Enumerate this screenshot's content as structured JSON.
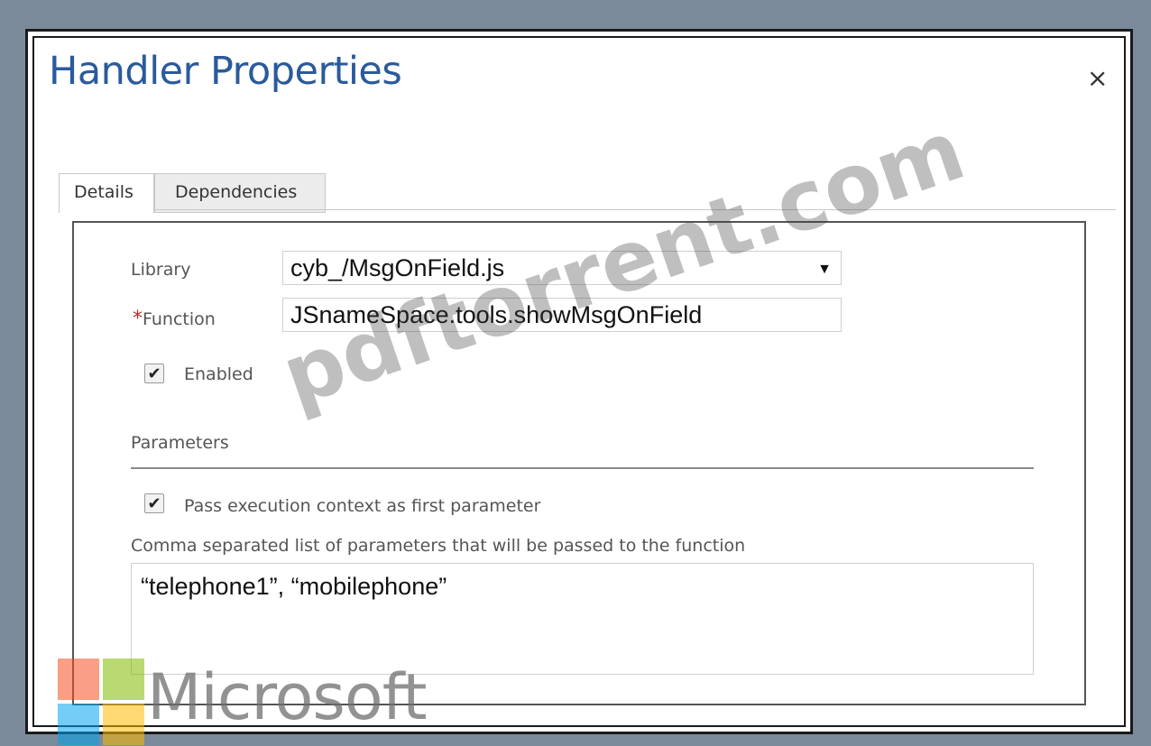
{
  "dialog": {
    "title": "Handler Properties",
    "close_symbol": "×"
  },
  "tabs": [
    {
      "label": "Details",
      "active": true
    },
    {
      "label": "Dependencies",
      "active": false
    }
  ],
  "form": {
    "library_label": "Library",
    "library_value": "cyb_/MsgOnField.js",
    "function_required_mark": "*",
    "function_label": "Function",
    "function_value": "JSnameSpace.tools.showMsgOnField",
    "enabled_label": "Enabled",
    "enabled_checked": true,
    "parameters_heading": "Parameters",
    "pass_context_label": "Pass execution context as first parameter",
    "pass_context_checked": true,
    "params_list_label": "Comma separated list of parameters that will be passed to the function",
    "params_value": "“telephone1”, “mobilephone”"
  },
  "watermark": {
    "text": "pdftorrent.com"
  },
  "brand": {
    "word": "Microsoft",
    "logo_colors": [
      "#f25022",
      "#7fba00",
      "#00a4ef",
      "#ffb900"
    ]
  },
  "icons": {
    "close": "close-icon",
    "dropdown": "chevron-down-icon",
    "check": "checkmark-icon"
  }
}
